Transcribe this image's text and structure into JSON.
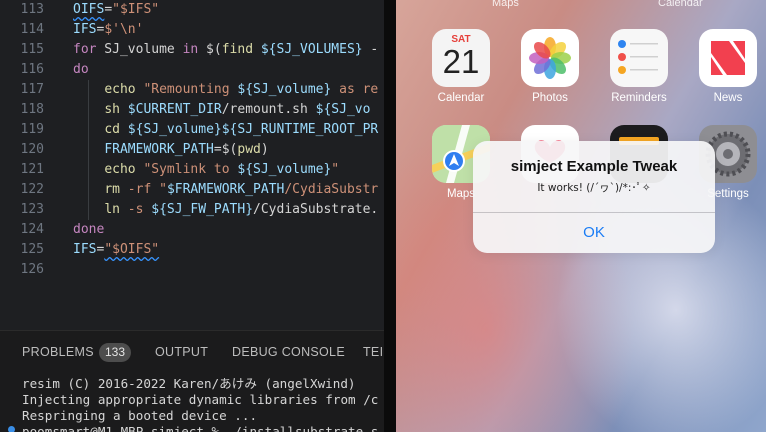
{
  "editor": {
    "lines": [
      {
        "no": "113",
        "tokens": [
          {
            "c": "vr",
            "t": "OIFS"
          },
          {
            "c": "pl",
            "t": "="
          },
          {
            "c": "st",
            "t": "\"$IFS\""
          }
        ]
      },
      {
        "no": "114",
        "tokens": [
          {
            "c": "vr",
            "t": "IFS"
          },
          {
            "c": "pl",
            "t": "="
          },
          {
            "c": "st",
            "t": "$'\\n'"
          }
        ]
      },
      {
        "no": "115",
        "tokens": [
          {
            "c": "kw",
            "t": "for"
          },
          {
            "c": "pl",
            "t": " SJ_volume "
          },
          {
            "c": "kw",
            "t": "in"
          },
          {
            "c": "pl",
            "t": " $("
          },
          {
            "c": "fn",
            "t": "find"
          },
          {
            "c": "pl",
            "t": " "
          },
          {
            "c": "vr",
            "t": "${SJ_VOLUMES}"
          },
          {
            "c": "pl",
            "t": " -"
          }
        ]
      },
      {
        "no": "116",
        "tokens": [
          {
            "c": "kw",
            "t": "do"
          }
        ]
      },
      {
        "no": "117",
        "tokens": [
          {
            "c": "pl",
            "t": "    "
          },
          {
            "c": "fn",
            "t": "echo"
          },
          {
            "c": "pl",
            "t": " "
          },
          {
            "c": "st",
            "t": "\"Remounting "
          },
          {
            "c": "vr",
            "t": "${SJ_volume}"
          },
          {
            "c": "st",
            "t": " as re"
          }
        ]
      },
      {
        "no": "118",
        "tokens": [
          {
            "c": "pl",
            "t": "    "
          },
          {
            "c": "fn",
            "t": "sh"
          },
          {
            "c": "pl",
            "t": " "
          },
          {
            "c": "vr",
            "t": "$CURRENT_DIR"
          },
          {
            "c": "pl",
            "t": "/remount.sh "
          },
          {
            "c": "vr",
            "t": "${SJ_vo"
          }
        ]
      },
      {
        "no": "119",
        "tokens": [
          {
            "c": "pl",
            "t": "    "
          },
          {
            "c": "fn",
            "t": "cd"
          },
          {
            "c": "pl",
            "t": " "
          },
          {
            "c": "vr",
            "t": "${SJ_volume}${SJ_RUNTIME_ROOT_PR"
          }
        ]
      },
      {
        "no": "120",
        "tokens": [
          {
            "c": "pl",
            "t": "    "
          },
          {
            "c": "vr",
            "t": "FRAMEWORK_PATH"
          },
          {
            "c": "pl",
            "t": "=$("
          },
          {
            "c": "fn",
            "t": "pwd"
          },
          {
            "c": "pl",
            "t": ")"
          }
        ]
      },
      {
        "no": "121",
        "tokens": [
          {
            "c": "pl",
            "t": "    "
          },
          {
            "c": "fn",
            "t": "echo"
          },
          {
            "c": "pl",
            "t": " "
          },
          {
            "c": "st",
            "t": "\"Symlink to "
          },
          {
            "c": "vr",
            "t": "${SJ_volume}"
          },
          {
            "c": "st",
            "t": "\""
          }
        ]
      },
      {
        "no": "122",
        "tokens": [
          {
            "c": "pl",
            "t": "    "
          },
          {
            "c": "fn",
            "t": "rm"
          },
          {
            "c": "pl",
            "t": " "
          },
          {
            "c": "st",
            "t": "-rf"
          },
          {
            "c": "pl",
            "t": " "
          },
          {
            "c": "st",
            "t": "\""
          },
          {
            "c": "vr",
            "t": "$FRAMEWORK_PATH"
          },
          {
            "c": "st",
            "t": "/CydiaSubstr"
          }
        ]
      },
      {
        "no": "123",
        "tokens": [
          {
            "c": "pl",
            "t": "    "
          },
          {
            "c": "fn",
            "t": "ln"
          },
          {
            "c": "pl",
            "t": " "
          },
          {
            "c": "st",
            "t": "-s"
          },
          {
            "c": "pl",
            "t": " "
          },
          {
            "c": "vr",
            "t": "${SJ_FW_PATH}"
          },
          {
            "c": "pl",
            "t": "/CydiaSubstrate."
          }
        ]
      },
      {
        "no": "124",
        "tokens": [
          {
            "c": "kw",
            "t": "done"
          }
        ]
      },
      {
        "no": "125",
        "tokens": [
          {
            "c": "vr",
            "t": "IFS"
          },
          {
            "c": "pl",
            "t": "="
          },
          {
            "c": "st",
            "t": "\"$OIFS\""
          }
        ]
      },
      {
        "no": "126",
        "tokens": []
      }
    ]
  },
  "panel": {
    "tabs": [
      {
        "label": "PROBLEMS",
        "name": "tab-problems"
      },
      {
        "label": "OUTPUT",
        "name": "tab-output"
      },
      {
        "label": "DEBUG CONSOLE",
        "name": "tab-debug-console"
      },
      {
        "label": "TEI",
        "name": "tab-terminal"
      }
    ],
    "problems_count": "133",
    "terminal_lines": [
      "resim (C) 2016-2022 Karen/あけみ (angelXwind)",
      "Injecting appropriate dynamic libraries from /c",
      "Respringing a booted device ...",
      "poomsmart@M1-MBP simject % ./installsubstrate.s"
    ]
  },
  "simulator": {
    "top_labels": [
      "Maps",
      "Calendar"
    ],
    "apps_row1": [
      {
        "label": "Calendar",
        "icon": "calendar-icon",
        "day": "SAT",
        "date": "21"
      },
      {
        "label": "Photos",
        "icon": "photos-icon"
      },
      {
        "label": "Reminders",
        "icon": "reminders-icon"
      },
      {
        "label": "News",
        "icon": "news-icon"
      }
    ],
    "apps_row2": [
      {
        "label": "Maps",
        "icon": "maps-icon"
      },
      {
        "label": "",
        "icon": "health-icon"
      },
      {
        "label": "",
        "icon": "wallet-icon"
      },
      {
        "label": "Settings",
        "icon": "settings-icon"
      }
    ],
    "alert": {
      "title": "simject Example Tweak",
      "message": "It works! (/´ヮ`)/*:･ﾟ✧",
      "ok_label": "OK"
    },
    "colors": {
      "alert_button": "#1a7cf5",
      "news_red": "#f2404f"
    }
  }
}
